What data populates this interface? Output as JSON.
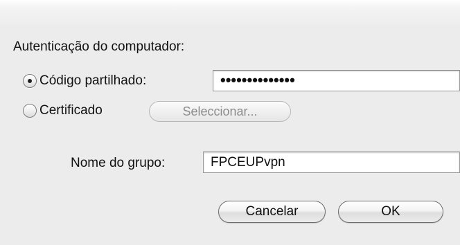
{
  "auth": {
    "section_title": "Autenticação do computador:",
    "shared_secret": {
      "label": "Código partilhado:",
      "selected": true,
      "value": "••••••••••••••"
    },
    "certificate": {
      "label": "Certificado",
      "selected": false,
      "select_button": "Seleccionar..."
    }
  },
  "group": {
    "label": "Nome do grupo:",
    "value": "FPCEUPvpn"
  },
  "buttons": {
    "cancel": "Cancelar",
    "ok": "OK"
  }
}
